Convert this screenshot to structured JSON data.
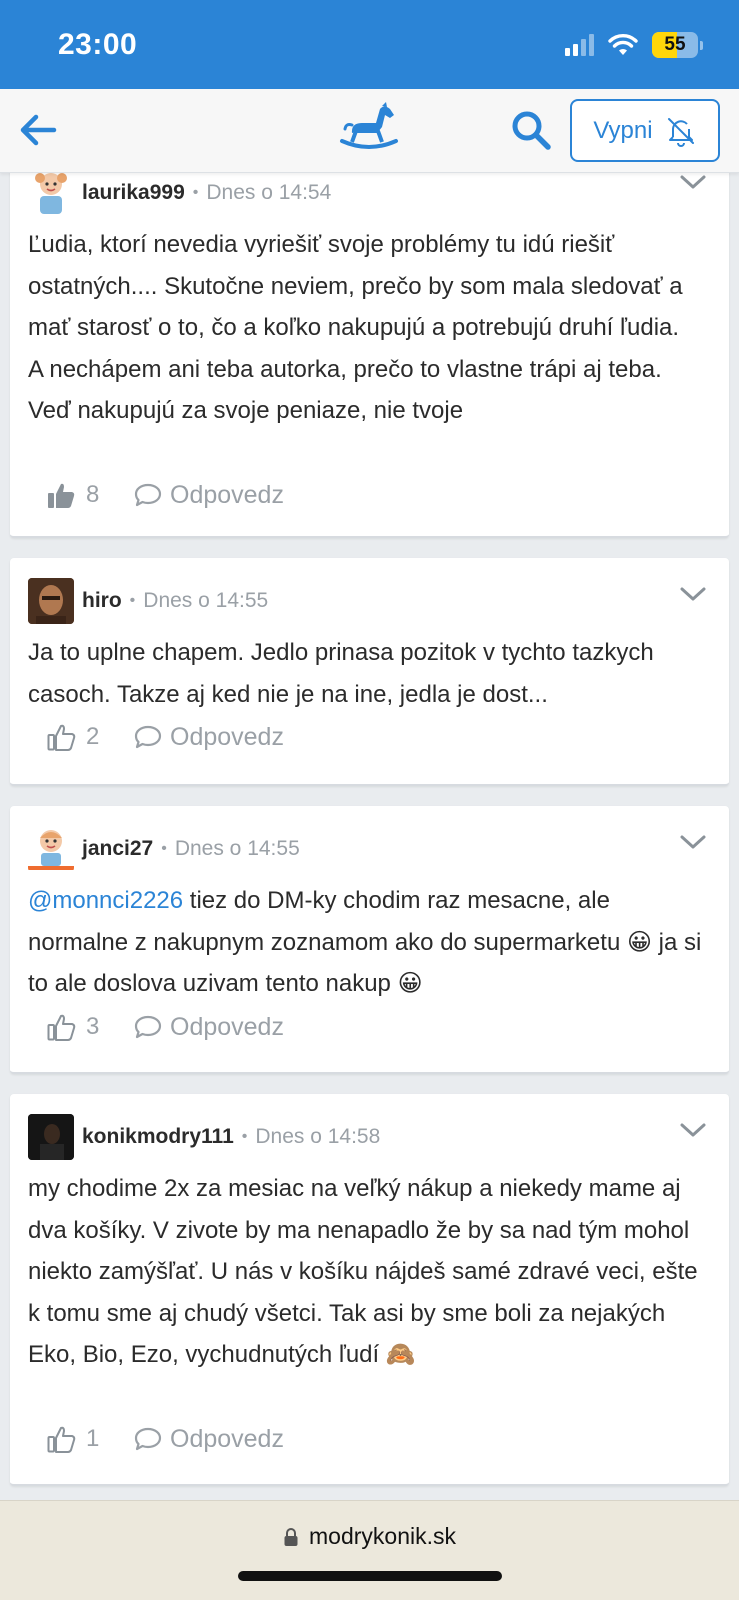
{
  "status_bar": {
    "time": "23:00",
    "battery_level": 55,
    "battery_label": "55",
    "icons": [
      "cellular-signal-icon",
      "wifi-icon",
      "battery-icon"
    ]
  },
  "nav": {
    "back_icon": "arrow-left-icon",
    "logo_icon": "rocking-horse-icon",
    "search_icon": "search-icon",
    "vypni_label": "Vypni",
    "vypni_icon": "bell-off-icon",
    "accent_color": "#2b84d6"
  },
  "comments": [
    {
      "username": "laurika999",
      "time": "Dnes o 14:54",
      "text": "Ľudia, ktorí nevedia vyriešiť svoje problémy tu idú riešiť ostatných.... Skutočne neviem, prečo by som mala sledovať a mať starosť o to, čo a koľko nakupujú a potrebujú druhí ľudia.",
      "text2": "A nechápem ani teba autorka, prečo to vlastne trápi aj teba. Veď nakupujú za svoje peniaze, nie tvoje",
      "likes": "8",
      "liked": true,
      "reply_label": "Odpovedz"
    },
    {
      "username": "hiro",
      "time": "Dnes o 14:55",
      "text": "Ja to uplne chapem. Jedlo prinasa pozitok v tychto tazkych casoch. Takze aj ked nie je na ine, jedla je dost...",
      "likes": "2",
      "liked": false,
      "reply_label": "Odpovedz"
    },
    {
      "username": "janci27",
      "time": "Dnes o 14:55",
      "mention": "@monnci2226",
      "text": " tiez do DM-ky chodim raz mesacne, ale normalne z nakupnym zoznamom ako do supermarketu ",
      "emoji1": "😀",
      "text2": " ja si to ale doslova uzivam tento nakup ",
      "emoji2": "😀",
      "likes": "3",
      "liked": false,
      "reply_label": "Odpovedz"
    },
    {
      "username": "konikmodry111",
      "time": "Dnes o 14:58",
      "text": "my chodime 2x za mesiac na veľký nákup a niekedy mame aj dva košíky. V zivote by ma nenapadlo že by sa nad tým mohol niekto zamýšľať. U nás v košíku nájdeš samé zdravé veci, ešte k tomu sme aj chudý všetci. Tak asi by sme boli za nejakých Eko, Bio, Ezo, vychudnutých ľudí ",
      "emoji": "🙈",
      "likes": "1",
      "liked": false,
      "reply_label": "Odpovedz"
    }
  ],
  "footer": {
    "url": "modrykonik.sk",
    "lock_icon": "lock-icon"
  }
}
